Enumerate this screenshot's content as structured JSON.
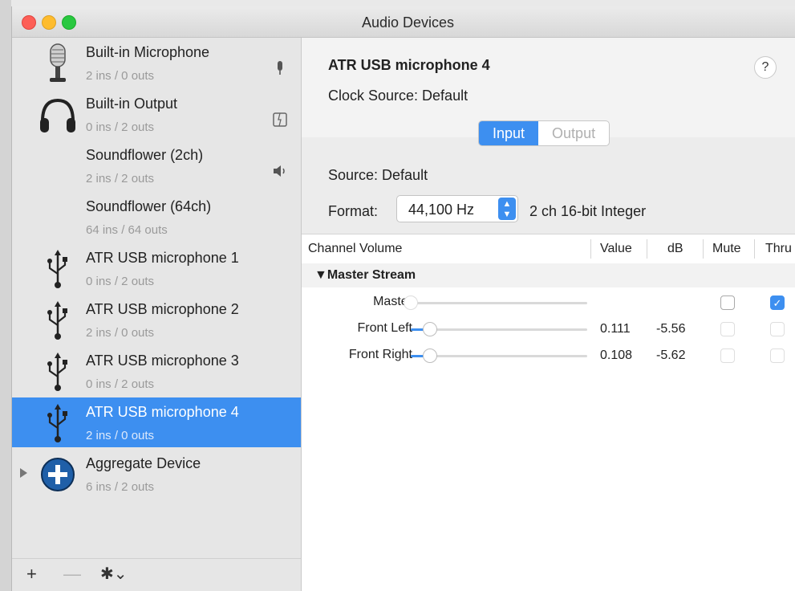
{
  "window": {
    "title": "Audio Devices"
  },
  "devices": [
    {
      "name": "Built-in Microphone",
      "io": "2 ins / 0 outs",
      "icon": "microphone-icon",
      "glyph": "mic-glyph-icon",
      "selected": false
    },
    {
      "name": "Built-in Output",
      "io": "0 ins / 2 outs",
      "icon": "headphones-icon",
      "glyph": "finder-glyph-icon",
      "selected": false
    },
    {
      "name": "Soundflower (2ch)",
      "io": "2 ins / 2 outs",
      "icon": "",
      "glyph": "speaker-glyph-icon",
      "selected": false
    },
    {
      "name": "Soundflower (64ch)",
      "io": "64 ins / 64 outs",
      "icon": "",
      "glyph": "",
      "selected": false
    },
    {
      "name": "ATR USB microphone 1",
      "io": "0 ins / 2 outs",
      "icon": "usb-icon",
      "glyph": "",
      "selected": false
    },
    {
      "name": "ATR USB microphone 2",
      "io": "2 ins / 0 outs",
      "icon": "usb-icon",
      "glyph": "",
      "selected": false
    },
    {
      "name": "ATR USB microphone 3",
      "io": "0 ins / 2 outs",
      "icon": "usb-icon",
      "glyph": "",
      "selected": false
    },
    {
      "name": "ATR USB microphone 4",
      "io": "2 ins / 0 outs",
      "icon": "usb-icon",
      "glyph": "",
      "selected": true
    },
    {
      "name": "Aggregate Device",
      "io": "6 ins / 2 outs",
      "icon": "aggregate-plus-icon",
      "glyph": "",
      "selected": false
    }
  ],
  "footer": {
    "add": "+",
    "remove": "—",
    "gear": "✱⌄"
  },
  "detail": {
    "title": "ATR USB microphone 4",
    "help": "?",
    "clock_source": "Clock Source:  Default",
    "tabs": [
      {
        "label": "Input",
        "active": true
      },
      {
        "label": "Output",
        "active": false
      }
    ],
    "source": "Source:  Default",
    "format_label": "Format:",
    "format_value": "44,100 Hz",
    "format_extra": "2 ch 16-bit Integer"
  },
  "table": {
    "headers": {
      "channel": "Channel Volume",
      "value": "Value",
      "db": "dB",
      "mute": "Mute",
      "thru": "Thru"
    },
    "group": "▼Master Stream",
    "rows": [
      {
        "label": "Master",
        "level": 0,
        "enabled": false,
        "value": "",
        "db": "",
        "mute": false,
        "mute_enabled": true,
        "thru": true,
        "thru_enabled": true
      },
      {
        "label": "Front Left",
        "level": 0.111,
        "enabled": true,
        "value": "0.111",
        "db": "-5.56",
        "mute": false,
        "mute_enabled": false,
        "thru": false,
        "thru_enabled": false
      },
      {
        "label": "Front Right",
        "level": 0.108,
        "enabled": true,
        "value": "0.108",
        "db": "-5.62",
        "mute": false,
        "mute_enabled": false,
        "thru": false,
        "thru_enabled": false
      }
    ]
  },
  "colors": {
    "accent": "#3d8ff0",
    "selected_row": "#3d8ff0"
  }
}
